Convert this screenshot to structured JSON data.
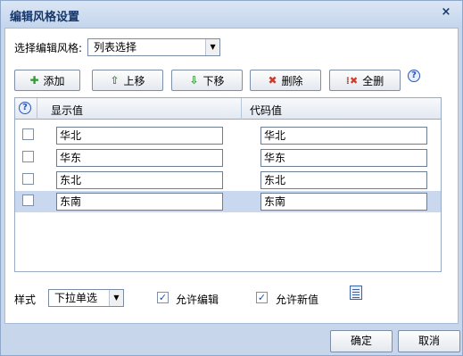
{
  "dialog": {
    "title": "编辑风格设置",
    "close_glyph": "×"
  },
  "style_select": {
    "label": "选择编辑风格:",
    "value": "列表选择"
  },
  "toolbar": {
    "add": "添加",
    "move_up": "上移",
    "move_down": "下移",
    "delete": "删除",
    "delete_all": "全删",
    "help_glyph": "?"
  },
  "grid": {
    "headers": {
      "help_glyph": "?",
      "display": "显示值",
      "code": "代码值"
    },
    "rows": [
      {
        "display": "华北",
        "code": "华北",
        "checked": false,
        "selected": false
      },
      {
        "display": "华东",
        "code": "华东",
        "checked": false,
        "selected": false
      },
      {
        "display": "东北",
        "code": "东北",
        "checked": false,
        "selected": false
      },
      {
        "display": "东南",
        "code": "东南",
        "checked": false,
        "selected": true
      }
    ]
  },
  "bottom": {
    "style_label": "样式",
    "style_value": "下拉单选",
    "allow_edit_label": "允许编辑",
    "allow_edit_checked": true,
    "allow_new_label": "允许新值",
    "allow_new_checked": true
  },
  "footer": {
    "ok": "确定",
    "cancel": "取消"
  },
  "icons": {
    "add": "plus-icon",
    "move_up": "arrow-up-icon",
    "move_down": "arrow-down-icon",
    "delete": "delete-x-icon",
    "delete_all": "delete-all-icon",
    "help": "help-icon",
    "doc": "document-icon"
  },
  "colors": {
    "plus": "#2f9a2f",
    "arrow": "#2f9a2f",
    "delete": "#d23a2a",
    "selected_row": "#c9d8ef",
    "title_text": "#15376b"
  }
}
